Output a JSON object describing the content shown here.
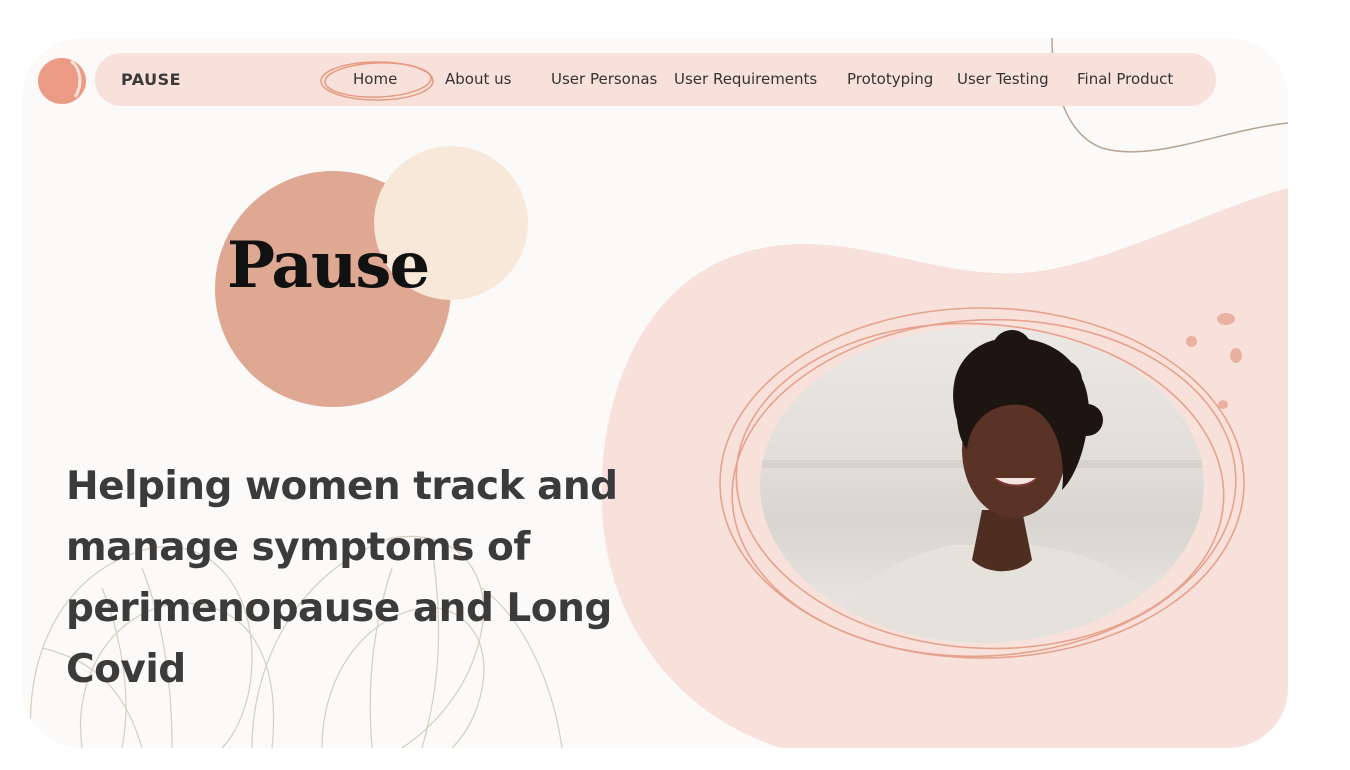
{
  "nav": {
    "brand": "PAUSE",
    "items": [
      {
        "label": "Home",
        "active": true
      },
      {
        "label": "About us",
        "active": false
      },
      {
        "label": "User Personas",
        "active": false
      },
      {
        "label": "User Requirements",
        "active": false
      },
      {
        "label": "Prototyping",
        "active": false
      },
      {
        "label": "User Testing",
        "active": false
      },
      {
        "label": "Final Product",
        "active": false
      }
    ]
  },
  "hero": {
    "title": "Pause",
    "tagline": "Helping women track and manage symptoms of perimenopause and Long Covid"
  },
  "colors": {
    "accent": "#dfa893",
    "cream": "#f8e8da",
    "blob": "#f9e1db",
    "card_bg": "#fcfaf9",
    "ring": "#e5a28c"
  }
}
